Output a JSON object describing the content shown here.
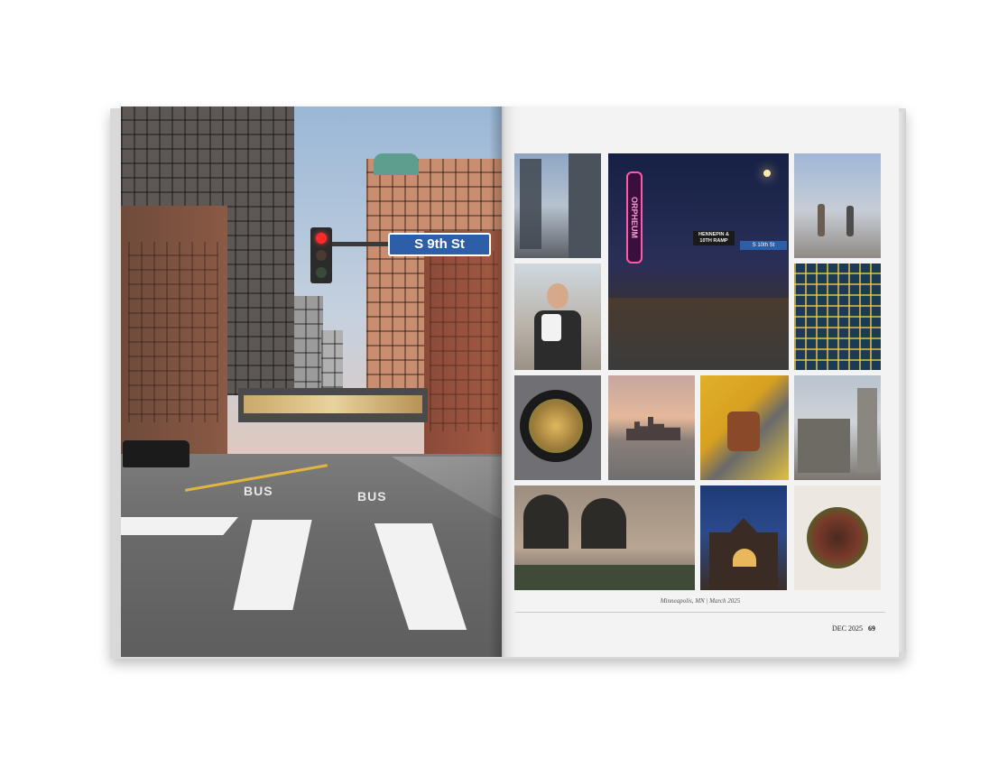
{
  "left_page": {
    "street_sign": "S 9th St",
    "road_marking_1": "BUS",
    "road_marking_2": "BUS"
  },
  "right_page": {
    "photos": [
      {
        "name": "skyscrapers-photo"
      },
      {
        "name": "orpheum-night-photo",
        "marquee": "ORPHEUM",
        "sign": "HENNEPIN & 10TH RAMP",
        "street_sign": "S 10th St"
      },
      {
        "name": "street-people-photo"
      },
      {
        "name": "person-with-jugs-photo"
      },
      {
        "name": "skyway-map-photo"
      },
      {
        "name": "ramen-bowl-photo"
      },
      {
        "name": "skyline-sunset-photo"
      },
      {
        "name": "lego-display-photo"
      },
      {
        "name": "mill-ruins-photo"
      },
      {
        "name": "storefront-photo"
      },
      {
        "name": "church-photo"
      },
      {
        "name": "plated-dish-photo"
      }
    ],
    "caption": "Minneapolis, MN | March 2025",
    "folio_month": "DEC 2025",
    "folio_page": "69"
  },
  "colors": {
    "sign_blue": "#2d5fa8",
    "page_bg": "#f3f3f3",
    "neon_pink": "#ff5aa8"
  }
}
